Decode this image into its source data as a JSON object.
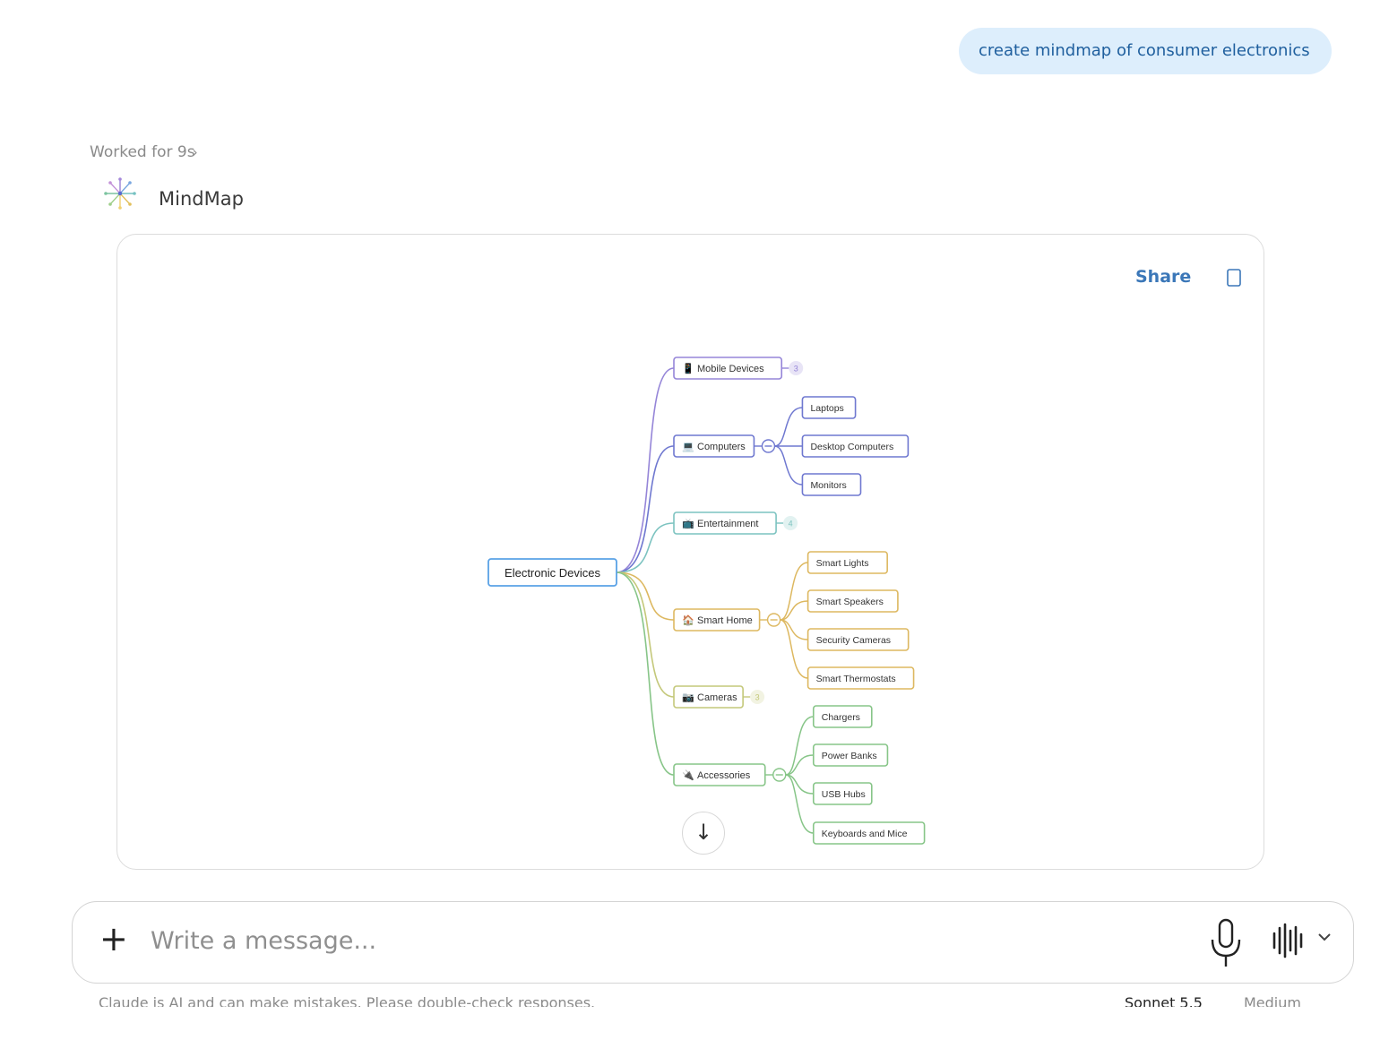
{
  "user_message": "create mindmap of consumer electronics",
  "status": {
    "worked": "Worked for 9s"
  },
  "artifact": {
    "name": "MindMap",
    "share_label": "Share",
    "root": "Electronic Devices",
    "branches": [
      {
        "label": "Mobile Devices",
        "emoji": "📱",
        "color": "#9585d8",
        "collapsed_count": "3",
        "children": []
      },
      {
        "label": "Computers",
        "emoji": "💻",
        "color": "#6f78d0",
        "children": [
          "Laptops",
          "Desktop Computers",
          "Monitors"
        ]
      },
      {
        "label": "Entertainment",
        "emoji": "📺",
        "color": "#7cc3c0",
        "collapsed_count": "4",
        "children": []
      },
      {
        "label": "Smart Home",
        "emoji": "🏠",
        "color": "#ddb860",
        "children": [
          "Smart Lights",
          "Smart Speakers",
          "Security Cameras",
          "Smart Thermostats"
        ]
      },
      {
        "label": "Cameras",
        "emoji": "📷",
        "color": "#c4c87a",
        "collapsed_count": "3",
        "children": []
      },
      {
        "label": "Accessories",
        "emoji": "🔌",
        "color": "#87c588",
        "children": [
          "Chargers",
          "Power Banks",
          "USB Hubs",
          "Keyboards and Mice"
        ]
      }
    ]
  },
  "composer": {
    "placeholder": "Write a message..."
  },
  "footer": {
    "disclaimer": "Claude is AI and can make mistakes. Please double-check responses.",
    "model": "Sonnet 5.5",
    "effort": "Medium"
  },
  "icons": {
    "scroll": "arrow-down-icon",
    "copy": "copy-icon",
    "add": "plus-icon",
    "mic": "microphone-icon",
    "voice": "voice-waveform-icon",
    "dropdown": "chevron-down-icon"
  }
}
